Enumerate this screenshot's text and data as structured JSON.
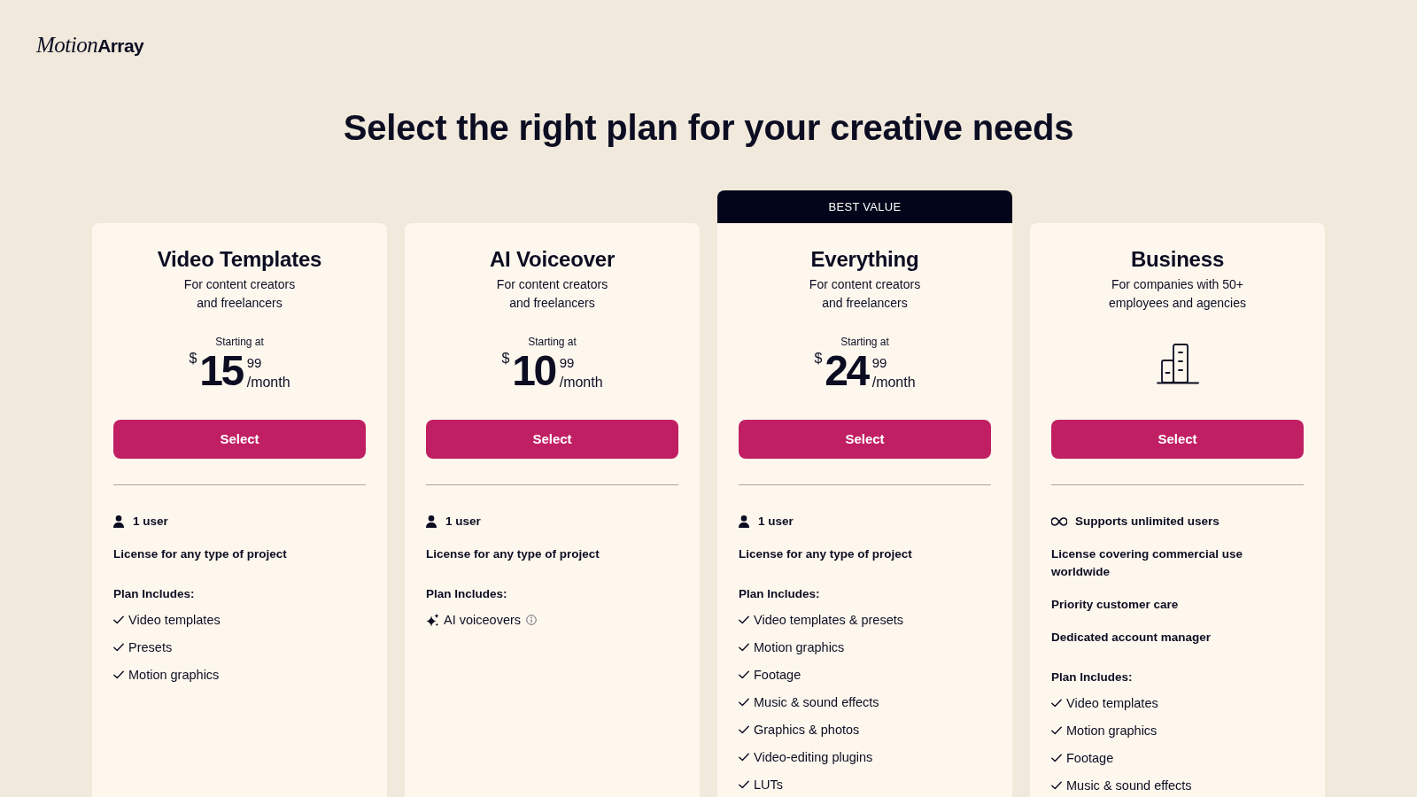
{
  "logo": [
    "Motion",
    "Array"
  ],
  "heading": "Select the right plan for your creative needs",
  "plans": [
    {
      "name": "Video Templates",
      "description": "For content creators\nand freelancers",
      "price": {
        "label": "Starting at",
        "currency": "$",
        "amount": "15",
        "cents": "99",
        "period": "/month"
      },
      "button": "Select",
      "seats": {
        "kind": "single",
        "text": "1 user"
      },
      "perks": [
        "License for any type of project"
      ],
      "includes_label": "Plan Includes:",
      "includes": [
        {
          "kind": "check",
          "text": "Video templates"
        },
        {
          "kind": "check",
          "text": "Presets"
        },
        {
          "kind": "check",
          "text": "Motion graphics"
        }
      ]
    },
    {
      "name": "AI Voiceover",
      "description": "For content creators\nand freelancers",
      "price": {
        "label": "Starting at",
        "currency": "$",
        "amount": "10",
        "cents": "99",
        "period": "/month"
      },
      "button": "Select",
      "seats": {
        "kind": "single",
        "text": "1 user"
      },
      "perks": [
        "License for any type of project"
      ],
      "includes_label": "Plan Includes:",
      "includes": [
        {
          "kind": "ai",
          "text": "AI voiceovers"
        }
      ]
    },
    {
      "badge": "BEST VALUE",
      "name": "Everything",
      "description": "For content creators\nand freelancers",
      "price": {
        "label": "Starting at",
        "currency": "$",
        "amount": "24",
        "cents": "99",
        "period": "/month"
      },
      "button": "Select",
      "seats": {
        "kind": "single",
        "text": "1 user"
      },
      "perks": [
        "License for any type of project"
      ],
      "includes_label": "Plan Includes:",
      "includes": [
        {
          "kind": "check",
          "text": "Video templates & presets"
        },
        {
          "kind": "check",
          "text": "Motion graphics"
        },
        {
          "kind": "check",
          "text": "Footage"
        },
        {
          "kind": "check",
          "text": "Music & sound effects"
        },
        {
          "kind": "check",
          "text": "Graphics & photos"
        },
        {
          "kind": "check",
          "text": "Video-editing plugins"
        },
        {
          "kind": "check",
          "text": "LUTs"
        }
      ]
    },
    {
      "name": "Business",
      "description": "For companies with 50+\nemployees and agencies",
      "button": "Select",
      "seats": {
        "kind": "unlimited",
        "text": "Supports unlimited users"
      },
      "perks": [
        "License covering commercial use\nworldwide",
        "Priority customer care",
        "Dedicated account manager"
      ],
      "includes_label": "Plan Includes:",
      "includes": [
        {
          "kind": "check",
          "text": "Video templates"
        },
        {
          "kind": "check",
          "text": "Motion graphics"
        },
        {
          "kind": "check",
          "text": "Footage"
        },
        {
          "kind": "check",
          "text": "Music & sound effects"
        }
      ]
    }
  ]
}
